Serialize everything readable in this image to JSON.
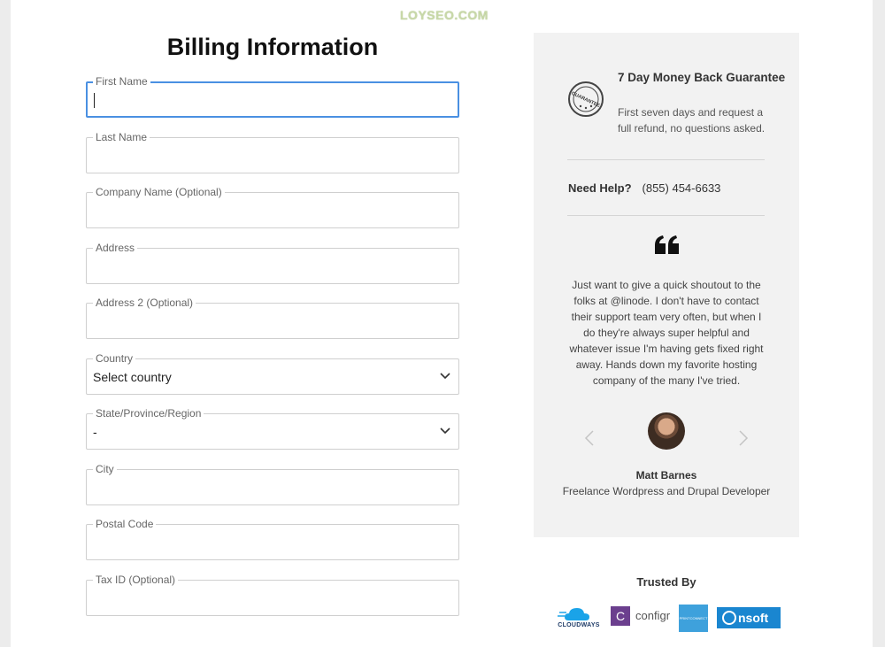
{
  "watermark": "LOYSEO.COM",
  "form": {
    "title": "Billing Information",
    "fields": [
      {
        "label": "First Name",
        "value": ""
      },
      {
        "label": "Last Name",
        "value": ""
      },
      {
        "label": "Company Name (Optional)",
        "value": ""
      },
      {
        "label": "Address",
        "value": ""
      },
      {
        "label": "Address 2 (Optional)",
        "value": ""
      },
      {
        "label": "Country",
        "value": "Select country"
      },
      {
        "label": "State/Province/Region",
        "value": "-"
      },
      {
        "label": "City",
        "value": ""
      },
      {
        "label": "Postal Code",
        "value": ""
      },
      {
        "label": "Tax ID (Optional)",
        "value": ""
      }
    ],
    "focus_color": "#4a90e2"
  },
  "sidebar": {
    "guarantee": {
      "icon": "guarantee-badge-icon",
      "badge_text": "GUARANTEE",
      "title": "7 Day Money Back Guarantee",
      "text": "First seven days and request a full refund, no questions asked."
    },
    "help": {
      "label": "Need Help?",
      "phone": "(855) 454-6633"
    },
    "testimonial": {
      "quote_icon": "quote-icon",
      "text": "Just want to give a quick shoutout to the folks at @linode. I don't have to contact their support team very often, but when I do they're always super helpful and whatever issue I'm having gets fixed right away. Hands down my favorite hosting company of the many I've tried.",
      "author": "Matt Barnes",
      "role": "Freelance Wordpress and Drupal Developer"
    }
  },
  "trusted": {
    "title": "Trusted By",
    "logos": [
      {
        "name": "CLOUDWAYS",
        "color": "#1aa3e8"
      },
      {
        "name": "configr",
        "mark": "C",
        "color": "#6b3f8e"
      },
      {
        "name": "PRINTCONNECT",
        "color": "#3ea1dc"
      },
      {
        "name": "nsoft",
        "color": "#1a86d0"
      }
    ]
  }
}
